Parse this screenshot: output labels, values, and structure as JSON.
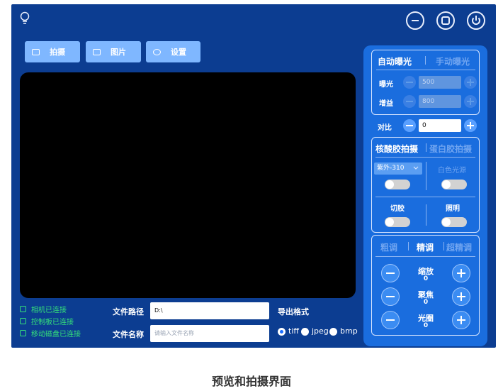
{
  "toolbar": {
    "capture_label": "拍摄",
    "images_label": "图片",
    "settings_label": "设置"
  },
  "status": {
    "camera": "相机已连接",
    "control_board": "控制板已连接",
    "disk": "移动磁盘已连接"
  },
  "file": {
    "path_label": "文件路径",
    "path_value": "D:\\",
    "name_label": "文件名称",
    "name_placeholder": "请输入文件名称"
  },
  "export": {
    "label": "导出格式",
    "options": [
      "tiff",
      "jpeg",
      "bmp"
    ],
    "selected": "tiff"
  },
  "exposure": {
    "auto_tab": "自动曝光",
    "manual_tab": "手动曝光",
    "exposure_label": "曝光",
    "exposure_value": "500",
    "gain_label": "增益",
    "gain_value": "800"
  },
  "contrast": {
    "label": "对比",
    "value": "0"
  },
  "mode": {
    "nucleic_tab": "核酸胶拍摄",
    "protein_tab": "蛋白胶拍摄",
    "light_select": "紫外-310",
    "white_light": "白色光源",
    "cut_label": "切胶",
    "lighting_label": "照明"
  },
  "lens": {
    "coarse_tab": "粗调",
    "fine_tab": "精调",
    "super_fine_tab": "超精调",
    "zoom_label": "缩放",
    "zoom_value": "0",
    "focus_label": "聚焦",
    "focus_value": "0",
    "aperture_label": "光圈",
    "aperture_value": "0"
  },
  "caption": "预览和拍摄界面",
  "icons": {
    "app": "lightbulb-icon",
    "minimize": "minus-circle-icon",
    "maximize": "square-circle-icon",
    "power": "power-icon"
  },
  "colors": {
    "background": "#0c3d91",
    "panel": "#1a6dde",
    "status_ok": "#35e07a"
  }
}
